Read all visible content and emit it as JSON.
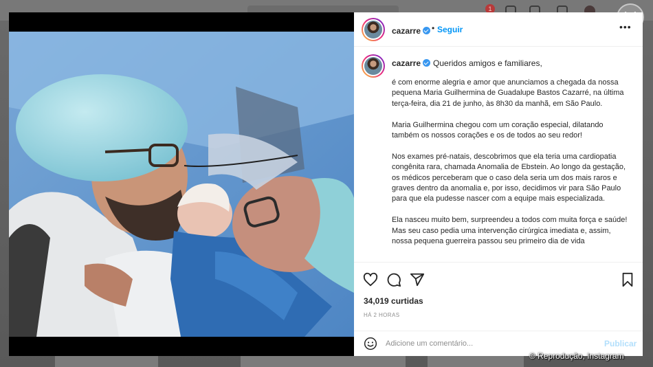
{
  "post": {
    "username": "cazarre",
    "follow_label": "Seguir",
    "more_label": "•••",
    "separator": "•",
    "caption_first_line": "Queridos amigos e familiares,",
    "caption_paragraphs": [
      "é com enorme alegria e amor que anunciamos a chegada da nossa pequena Maria Guilhermina de Guadalupe Bastos Cazarré, na última terça-feira, dia 21 de junho, às 8h30 da manhã, em São Paulo.",
      "Maria Guilhermina chegou com um coração especial, dilatando também os nossos corações e os de todos ao seu redor!",
      "Nos exames pré-natais, descobrimos que ela teria uma cardiopatia congênita rara, chamada Anomalia de Ebstein. Ao longo da gestação, os médicos perceberam que o caso dela seria um dos mais raros e graves dentro da anomalia e, por isso, decidimos vir para São Paulo para que ela pudesse nascer com a equipe mais especializada.",
      "Ela nasceu muito bem, surpreendeu a todos com muita força e saúde! Mas seu caso pedia uma intervenção cirúrgica imediata e, assim, nossa pequena guerreira passou seu primeiro dia de vida"
    ],
    "likes": "34,019 curtidas",
    "time_ago": "HÁ 2 HORAS"
  },
  "comment": {
    "placeholder": "Adicione um comentário...",
    "publish_label": "Publicar"
  },
  "backdrop": {
    "notification_count": "1"
  },
  "watermark": "© Reprodução, Instagram",
  "colors": {
    "link_blue": "#0095f6",
    "verified_blue": "#3897f0",
    "publish_disabled": "#b2dffc",
    "muted_text": "#8e8e8e"
  },
  "icons": [
    "heart-icon",
    "comment-icon",
    "share-icon",
    "bookmark-icon",
    "emoji-icon",
    "close-icon",
    "verified-badge-icon"
  ]
}
